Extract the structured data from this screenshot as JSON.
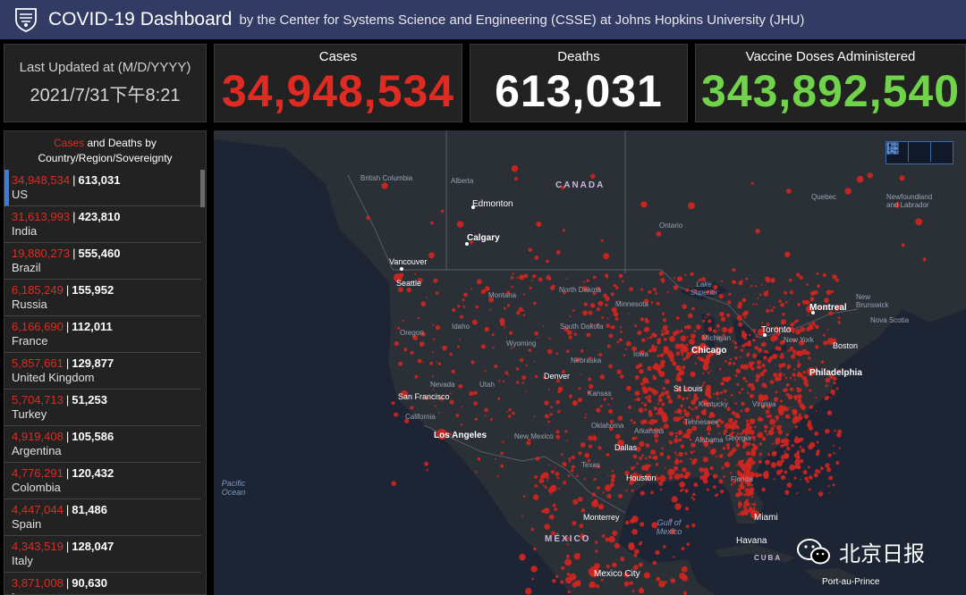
{
  "header": {
    "title": "COVID-19 Dashboard",
    "subtitle": "by the Center for Systems Science and Engineering (CSSE) at Johns Hopkins University (JHU)"
  },
  "updated": {
    "label": "Last Updated at (M/D/YYYY)",
    "value": "2021/7/31下午8:21"
  },
  "stats": {
    "cases": {
      "label": "Cases",
      "value": "34,948,534"
    },
    "deaths": {
      "label": "Deaths",
      "value": "613,031"
    },
    "vaccine": {
      "label": "Vaccine Doses Administered",
      "value": "343,892,540"
    }
  },
  "panel": {
    "title_cases": "Cases",
    "title_and": " and ",
    "title_deaths": "Deaths",
    "title_rest": " by Country/Region/Sovereignty",
    "rows": [
      {
        "cases": "34,948,534",
        "deaths": "613,031",
        "name": "US"
      },
      {
        "cases": "31,613,993",
        "deaths": "423,810",
        "name": "India"
      },
      {
        "cases": "19,880,273",
        "deaths": "555,460",
        "name": "Brazil"
      },
      {
        "cases": "6,185,249",
        "deaths": "155,952",
        "name": "Russia"
      },
      {
        "cases": "6,166,690",
        "deaths": "112,011",
        "name": "France"
      },
      {
        "cases": "5,857,661",
        "deaths": "129,877",
        "name": "United Kingdom"
      },
      {
        "cases": "5,704,713",
        "deaths": "51,253",
        "name": "Turkey"
      },
      {
        "cases": "4,919,408",
        "deaths": "105,586",
        "name": "Argentina"
      },
      {
        "cases": "4,776,291",
        "deaths": "120,432",
        "name": "Colombia"
      },
      {
        "cases": "4,447,044",
        "deaths": "81,486",
        "name": "Spain"
      },
      {
        "cases": "4,343,519",
        "deaths": "128,047",
        "name": "Italy"
      },
      {
        "cases": "3,871,008",
        "deaths": "90,630",
        "name": "Iran"
      }
    ]
  },
  "map": {
    "countries": {
      "canada": "CANADA",
      "mexico": "MÉXICO",
      "cuba": "CUBA"
    },
    "water": {
      "pacific": "Pacific Ocean",
      "gulf": "Gulf of Mexico",
      "superior": "Lake Superior"
    },
    "cities_major": {
      "edmonton": "Edmonton",
      "calgary": "Calgary",
      "vancouver": "Vancouver",
      "montreal": "Montreal",
      "toronto": "Toronto",
      "chicago": "Chicago",
      "miami": "Miami",
      "havana": "Havana",
      "mexico_city": "Mexico City",
      "port_au_prince": "Port-au-Prince"
    },
    "places": {
      "british_columbia": "British Columbia",
      "alberta": "Alberta",
      "ontario": "Ontario",
      "quebec": "Quebec",
      "newfoundland": "Newfoundland and Labrador",
      "new_brunswick": "New Brunswick",
      "nova_scotia": "Nova Scotia",
      "seattle": "Seattle",
      "montana": "Montana",
      "north_dakota": "North Dakota",
      "minnesota": "Minnesota",
      "oregon": "Oregon",
      "idaho": "Idaho",
      "south_dakota": "South Dakota",
      "wyoming": "Wyoming",
      "nebraska": "Nebraska",
      "iowa": "Iowa",
      "michigan": "Michigan",
      "new_york": "New York",
      "boston": "Boston",
      "philadelphia": "Philadelphia",
      "nevada": "Nevada",
      "utah": "Utah",
      "denver": "Denver",
      "san_francisco": "San Francisco",
      "california": "California",
      "kansas": "Kansas",
      "st_louis": "St Louis",
      "kentucky": "Kentucky",
      "virginia": "Virginia",
      "los_angeles": "Los Angeles",
      "new_mexico": "New Mexico",
      "oklahoma": "Oklahoma",
      "dallas": "Dallas",
      "texas": "Texas",
      "houston": "Houston",
      "monterrey": "Monterrey",
      "florida": "Florida",
      "georgia": "Georgia",
      "alabama": "Alabama",
      "arkansas": "Arkansas",
      "tennessee": "Tennessee"
    }
  },
  "watermark": "北京日报",
  "colors": {
    "header_bg": "#323b63",
    "cases": "#e02b22",
    "vaccine": "#70d34a",
    "panel_bg": "#222222",
    "map_bg": "#1d2433"
  }
}
